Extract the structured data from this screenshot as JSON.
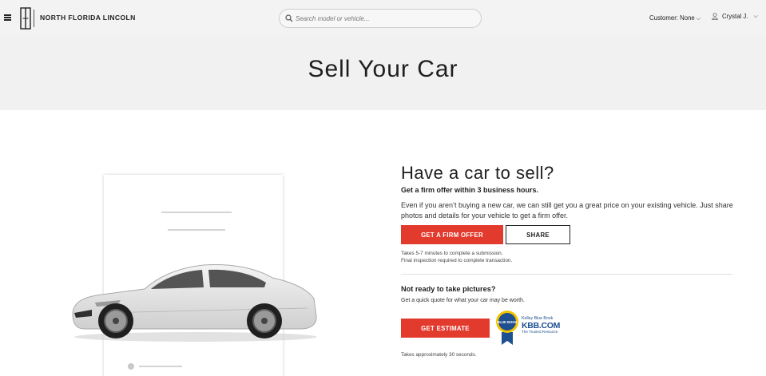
{
  "header": {
    "dealer_name": "NORTH FLORIDA LINCOLN",
    "search_placeholder": "Search model or vehicle...",
    "customer_label": "Customer: None",
    "user_name": "Crystal J."
  },
  "hero": {
    "title": "Sell Your Car"
  },
  "sell": {
    "heading": "Have a car to sell?",
    "subtitle": "Get a firm offer within 3 business hours.",
    "description": "Even if you aren’t buying a new car, we can still get you a great price on your existing vehicle. Just share photos and details for your vehicle to get a firm offer.",
    "primary_button": "GET A FIRM OFFER",
    "share_button": "SHARE",
    "note_line1": "Takes 5-7 minutes to complete a submission.",
    "note_line2": "Final inspection required to complete transaction."
  },
  "estimate": {
    "heading": "Not ready to take pictures?",
    "text": "Get a quick quote for what your car may be worth.",
    "button": "GET ESTIMATE",
    "note": "Takes approximately 30 seconds."
  },
  "kbb": {
    "title": "Kelley Blue Book",
    "domain": "KBB.COM",
    "tagline": "The Trusted Resource",
    "badge_text": "BLUE BOOK"
  },
  "icons": {
    "menu": "hamburger-icon",
    "logo": "lincoln-logo",
    "search": "search-icon",
    "user": "user-icon",
    "chevron": "chevron-down-icon"
  },
  "colors": {
    "accent": "#e23b2e",
    "header_bg": "#f3f3f3",
    "hero_bg": "#f1f1f1",
    "kbb_blue": "#1d4f91"
  }
}
